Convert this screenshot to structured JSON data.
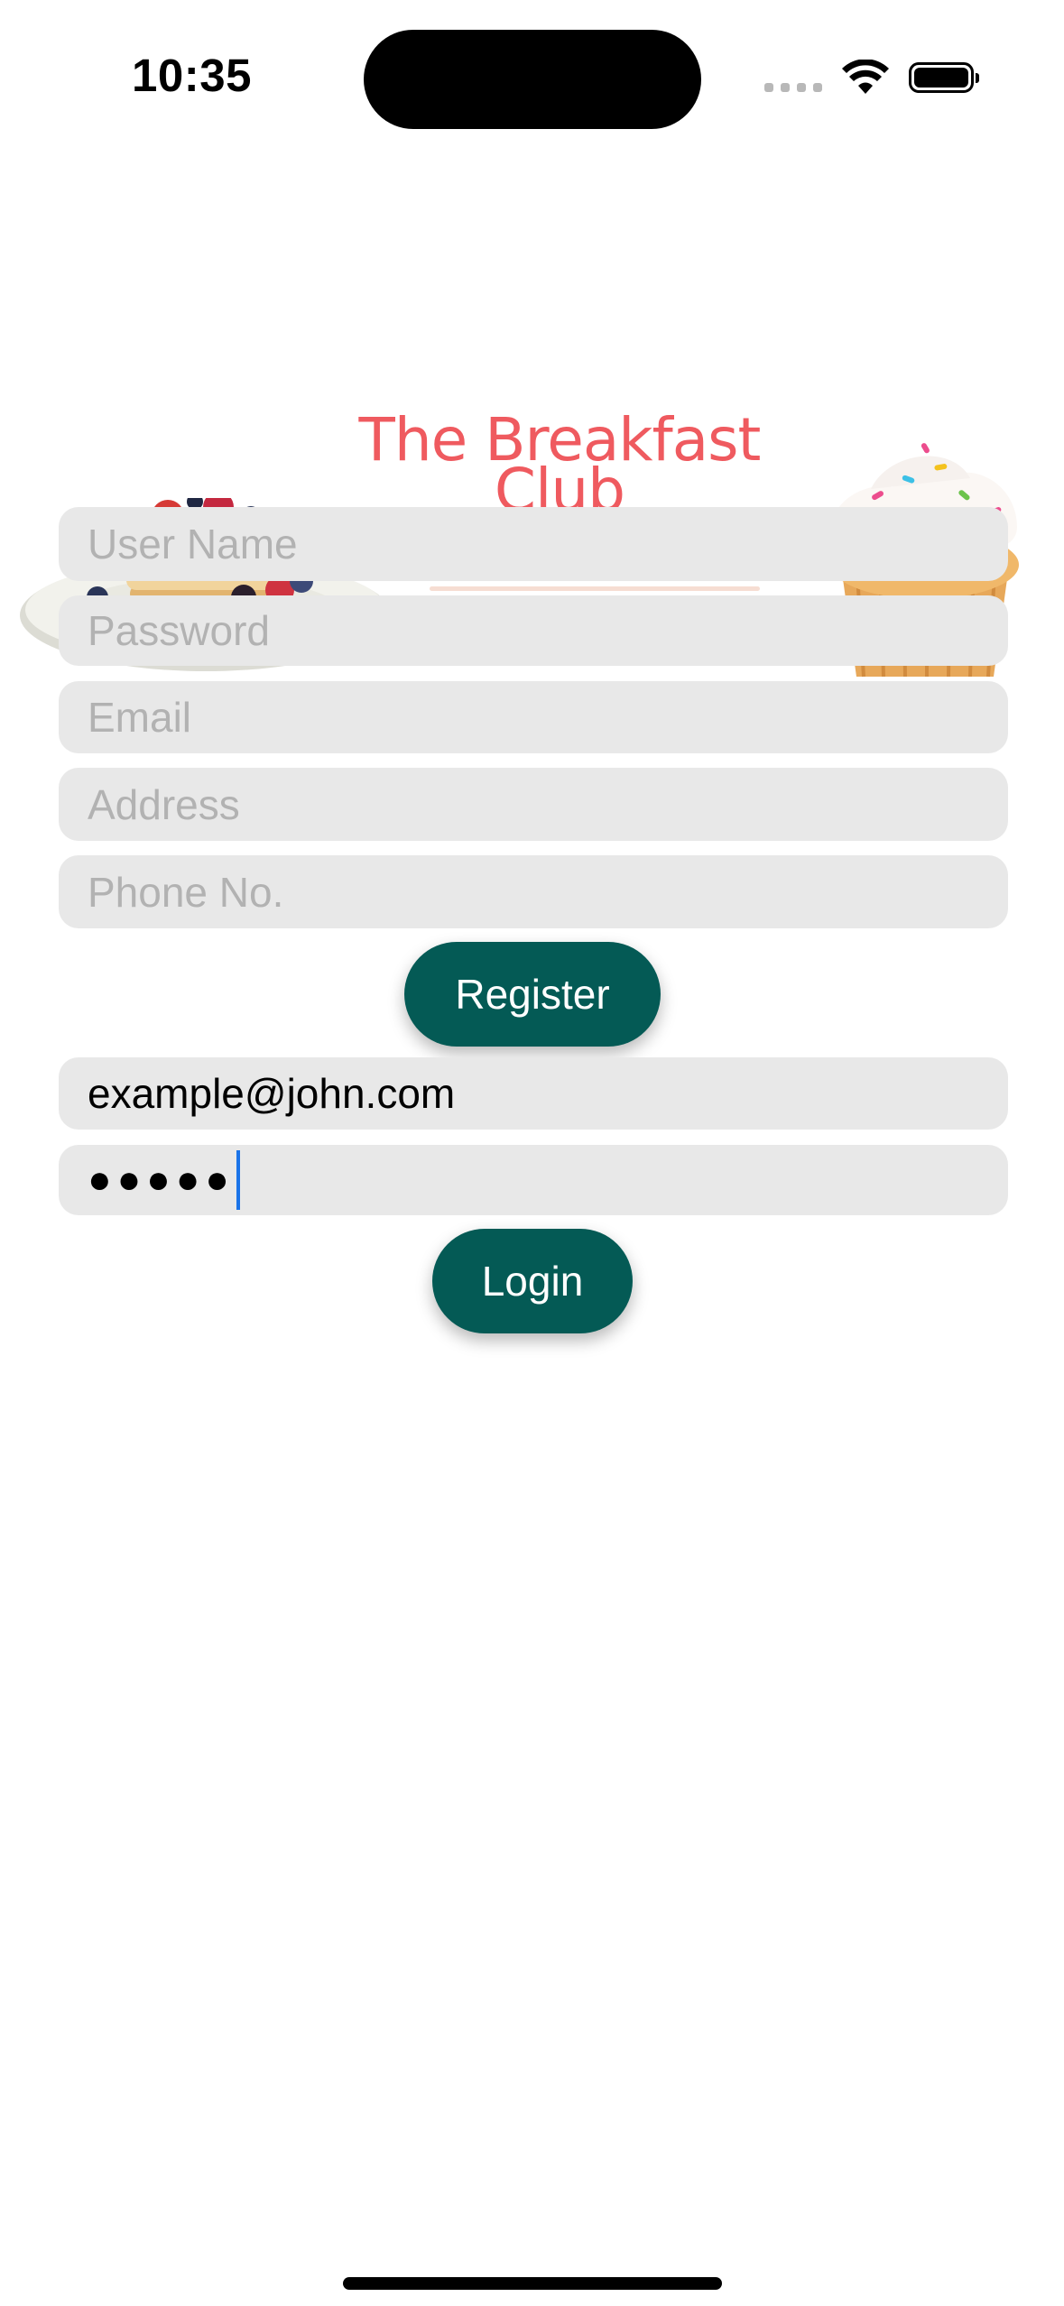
{
  "status_bar": {
    "time": "10:35"
  },
  "header": {
    "title_line1": "The Breakfast",
    "title_line2": "Club"
  },
  "register_form": {
    "username_placeholder": "User Name",
    "password_placeholder": "Password",
    "email_placeholder": "Email",
    "address_placeholder": "Address",
    "phone_placeholder": "Phone No.",
    "register_label": "Register"
  },
  "login_form": {
    "email_value": "example@john.com",
    "password_value": "●●●●●",
    "login_label": "Login"
  },
  "icons": {
    "illustrations": [
      "pancake-plate-illustration",
      "cupcake-illustration"
    ],
    "status": [
      "cellular-signal-icon",
      "wifi-icon",
      "battery-icon"
    ]
  },
  "colors": {
    "brand_title": "#ef5a5f",
    "button": "#045a55",
    "field_bg": "#e8e8e8",
    "placeholder": "#b2b2b2",
    "caret": "#1a73e8"
  }
}
